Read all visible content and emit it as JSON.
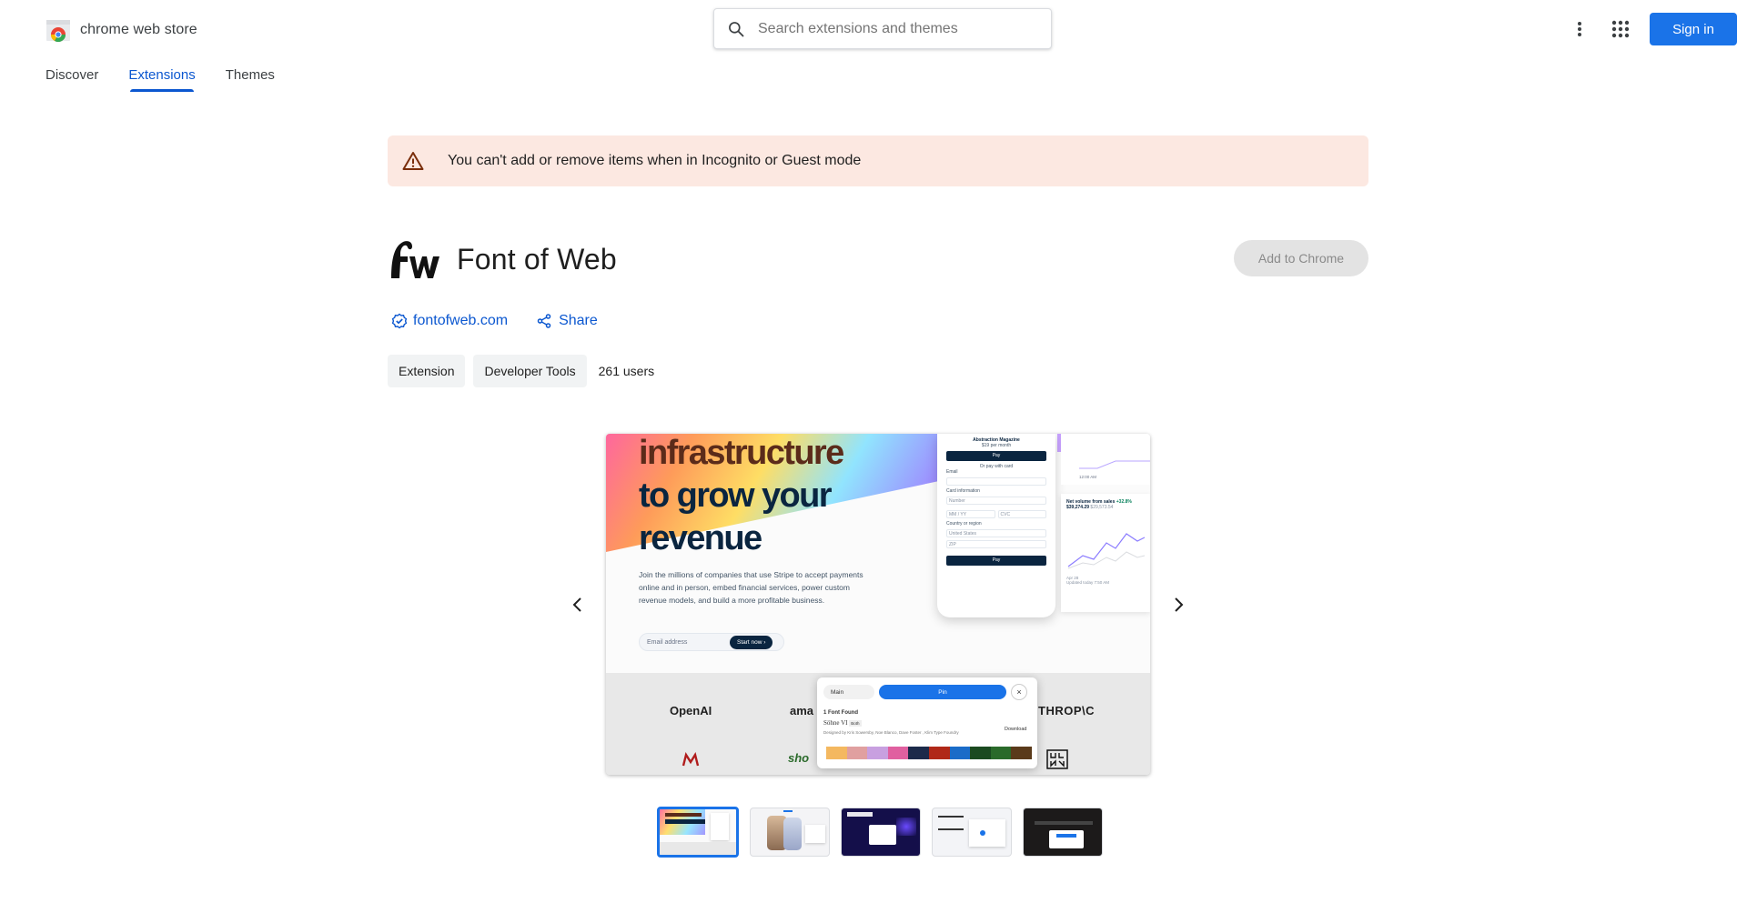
{
  "header": {
    "brand": "chrome web store",
    "search_placeholder": "Search extensions and themes",
    "sign_in": "Sign in"
  },
  "nav": {
    "tabs": [
      {
        "label": "Discover",
        "active": false
      },
      {
        "label": "Extensions",
        "active": true
      },
      {
        "label": "Themes",
        "active": false
      }
    ]
  },
  "warning": {
    "text": "You can't add or remove items when in Incognito or Guest mode"
  },
  "extension": {
    "name": "Font of Web",
    "add_button": "Add to Chrome",
    "website": "fontofweb.com",
    "share": "Share",
    "chips": [
      "Extension",
      "Developer Tools"
    ],
    "users": "261 users"
  },
  "screenshot": {
    "hero_line1": "infrastructure",
    "hero_line2": "to grow your",
    "hero_line3": "revenue",
    "hero_sub": "Join the millions of companies that use Stripe to accept payments online and in person, embed financial services, power custom revenue models, and build a more profitable business.",
    "email_placeholder": "Email address",
    "start_now": "Start now ›",
    "phone_title": "Abstraction Magazine",
    "phone_price": "$19 per month",
    "phone_pay": " Pay",
    "phone_or": "Or pay with card",
    "phone_email": "Email",
    "phone_card": "Card information",
    "phone_number": "Number",
    "phone_expiry": "MM / YY",
    "phone_cvc": "CVC",
    "phone_country": "Country or region",
    "phone_us": "United States",
    "phone_zip": "ZIP",
    "phone_paybtn": "Pay",
    "chart_time": "12:00 AM",
    "chart_title": "Net volume from sales",
    "chart_delta": "+32.8%",
    "chart_value": "$39,274.29",
    "chart_prev": "$29,573.54",
    "chart_date": "Apr 28",
    "chart_updated": "Updated today 7:50 AM",
    "logos": [
      "OpenAI",
      "ama",
      "THROP\\C",
      "sho"
    ],
    "popup_select": "Main",
    "popup_pin": "Pin",
    "popup_found": "1 Font Found",
    "popup_font": "Söhne VI",
    "popup_font_tag": "Both",
    "popup_designer": "Designed by Kris Sowersby, Noe Blanco, Dave Foster , Klim Type Foundry",
    "popup_download": "Download",
    "swatch_colors": [
      "#f4b860",
      "#e0a0a0",
      "#c8a0e0",
      "#e060a0",
      "#1c2a4a",
      "#b02818",
      "#1a6cc8",
      "#1a4a20",
      "#2a6a2a",
      "#5a3a1a"
    ]
  },
  "thumbnails": [
    {
      "label": "thumbnail-1",
      "active": true
    },
    {
      "label": "thumbnail-2",
      "active": false
    },
    {
      "label": "thumbnail-3",
      "active": false
    },
    {
      "label": "thumbnail-4",
      "active": false
    },
    {
      "label": "thumbnail-5",
      "active": false
    }
  ],
  "colors": {
    "accent": "#0b57d0",
    "signin_bg": "#1a73e8",
    "warning_bg": "#fce8e1"
  }
}
